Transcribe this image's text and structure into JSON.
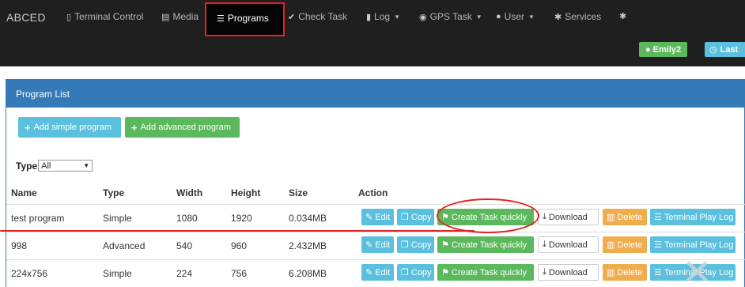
{
  "navbar": {
    "brand": "ABCED",
    "items": [
      {
        "label": "Terminal Control",
        "icon": "mobile-icon"
      },
      {
        "label": "Media",
        "icon": "film-icon"
      },
      {
        "label": "Programs",
        "icon": "list-icon",
        "active": true
      },
      {
        "label": "Check Task",
        "icon": "check-circle-icon"
      },
      {
        "label": "Log",
        "icon": "file-icon",
        "dropdown": true
      },
      {
        "label": "GPS Task",
        "icon": "globe-icon",
        "dropdown": true
      },
      {
        "label": "User",
        "icon": "user-icon",
        "dropdown": true
      },
      {
        "label": "Services",
        "icon": "gear-icon"
      }
    ],
    "user_badge": "Emily2",
    "last_badge": "Last"
  },
  "panel": {
    "title": "Program List",
    "add_simple": "Add simple program",
    "add_advanced": "Add advanced program",
    "type_label": "Type",
    "type_value": "All"
  },
  "table": {
    "headers": [
      "Name",
      "Type",
      "Width",
      "Height",
      "Size",
      "Action"
    ],
    "rows": [
      {
        "name": "test program",
        "type": "Simple",
        "width": "1080",
        "height": "1920",
        "size": "0.034MB"
      },
      {
        "name": "998",
        "type": "Advanced",
        "width": "540",
        "height": "960",
        "size": "2.432MB"
      },
      {
        "name": "224x756",
        "type": "Simple",
        "width": "224",
        "height": "756",
        "size": "6.208MB"
      }
    ],
    "actions": {
      "edit": "Edit",
      "copy": "Copy",
      "create_task": "Create Task quickly",
      "download": "Download",
      "delete": "Delete",
      "play_log": "Terminal Play Log"
    }
  },
  "colors": {
    "navbar_bg": "#1f1f1f",
    "panel_primary": "#337ab7",
    "info": "#5bc0de",
    "success": "#5cb85c",
    "warning": "#f0ad4e",
    "highlight": "#e02424"
  }
}
